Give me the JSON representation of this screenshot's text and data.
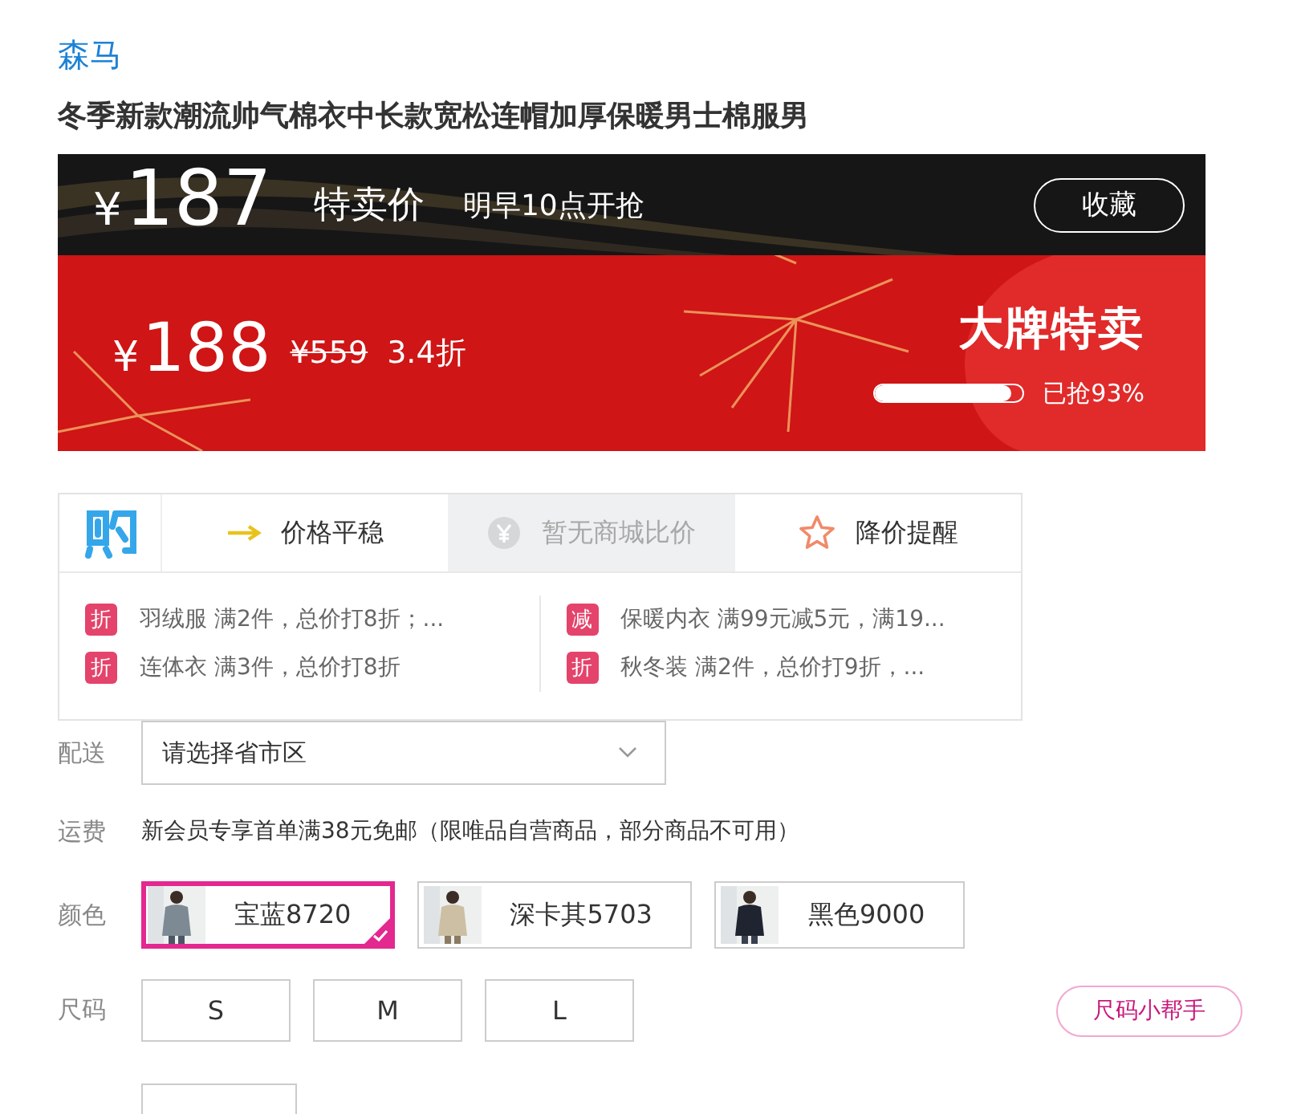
{
  "brand": "森马",
  "title": "冬季新款潮流帅气棉衣中长款宽松连帽加厚保暖男士棉服男",
  "banner": {
    "flash_price": "187",
    "currency": "¥",
    "flash_label": "特卖价",
    "start_time": "明早10点开抢",
    "favorite_button": "收藏",
    "price": "188",
    "original_price": "¥559",
    "discount": "3.4折",
    "badge": "大牌特卖",
    "level": 0.93,
    "sold_text": "已抢93%"
  },
  "price_info": {
    "tabs": [
      {
        "kind": "trend",
        "label": "价格平稳",
        "disabled": false
      },
      {
        "kind": "compare",
        "label": "暂无商城比价",
        "disabled": true
      },
      {
        "kind": "alert",
        "label": "降价提醒",
        "disabled": false
      }
    ],
    "promotions": [
      {
        "tag": "折",
        "text": "羽绒服 满2件，总价打8折；..."
      },
      {
        "tag": "减",
        "text": "保暖内衣 满99元减5元，满19..."
      },
      {
        "tag": "折",
        "text": "连体衣 满3件，总价打8折"
      },
      {
        "tag": "折",
        "text": "秋冬装 满2件，总价打9折，..."
      }
    ]
  },
  "delivery": {
    "label": "配送",
    "placeholder": "请选择省市区"
  },
  "shipping": {
    "label": "运费",
    "text": "新会员专享首单满38元免邮（限唯品自营商品，部分商品不可用）"
  },
  "colors": {
    "label": "颜色",
    "options": [
      {
        "label": "宝蓝8720",
        "selected": true,
        "kind": "picture"
      },
      {
        "label": "深卡其5703",
        "selected": false,
        "kind": "picture"
      },
      {
        "label": "黑色9000",
        "selected": false,
        "kind": "picture"
      }
    ]
  },
  "sizes": {
    "label": "尺码",
    "options": [
      {
        "label": "S",
        "selected": false
      },
      {
        "label": "M",
        "selected": false
      },
      {
        "label": "L",
        "selected": false
      }
    ],
    "helper_button": "尺码小帮手"
  }
}
